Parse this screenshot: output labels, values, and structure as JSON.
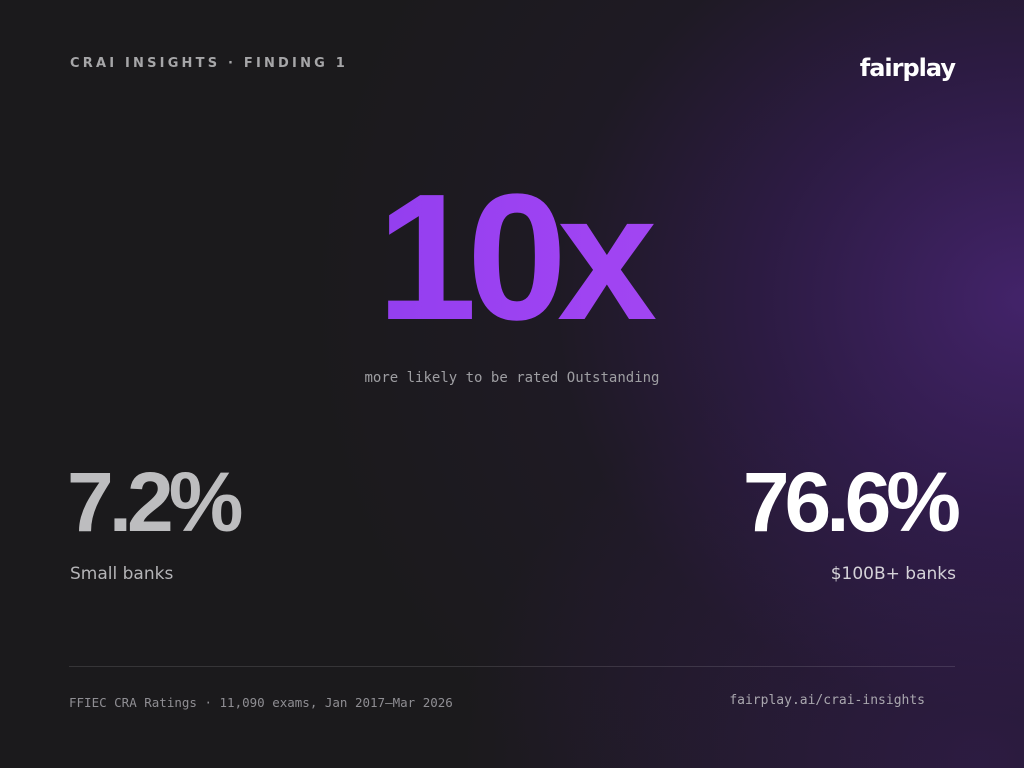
{
  "header": {
    "eyebrow": "CRAI INSIGHTS · FINDING 1",
    "logo_text": "fairplay"
  },
  "hero": {
    "value": "10x",
    "caption": "more likely to be rated Outstanding"
  },
  "stats": {
    "left": {
      "value": "7.2%",
      "label": "Small banks"
    },
    "right": {
      "value": "76.6%",
      "label": "$100B+ banks"
    }
  },
  "footer": {
    "source": "FFIEC CRA Ratings · 11,090 exams, Jan 2017–Mar 2026",
    "url": "fairplay.ai/crai-insights"
  },
  "colors": {
    "background": "#1b1a1c",
    "accent_purple": "#9a3ef0",
    "glow_purple": "#462470"
  }
}
